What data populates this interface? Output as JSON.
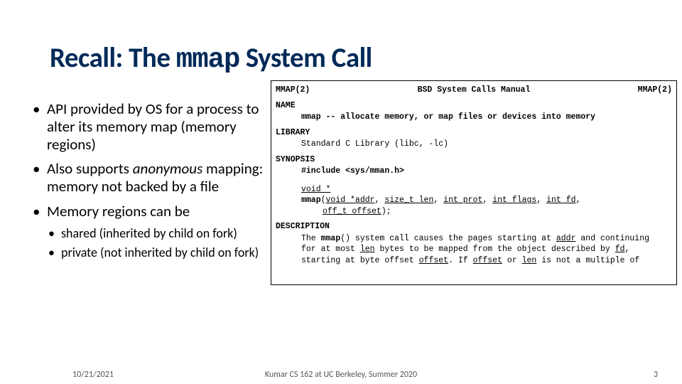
{
  "title": {
    "prefix": "Recall: The ",
    "code": "mmap",
    "suffix": " System Call"
  },
  "bullets": {
    "b1": "API provided by OS for a process to alter its memory map (memory regions)",
    "b2_pre": "Also supports ",
    "b2_em": "anonymous",
    "b2_post": " mapping: memory not backed by a file",
    "b3": "Memory regions can be",
    "sub1": "shared (inherited by child on fork)",
    "sub2": "private (not inherited by child on fork)"
  },
  "man": {
    "hdr_left": "MMAP(2)",
    "hdr_center": "BSD System Calls Manual",
    "hdr_right": "MMAP(2)",
    "sect_name": "NAME",
    "name_line": "mmap -- allocate memory, or map files or devices into memory",
    "sect_lib": "LIBRARY",
    "lib_line": "Standard C Library (libc, -lc)",
    "sect_syn": "SYNOPSIS",
    "syn_include": "#include <sys/mman.h>",
    "syn_ret_u": "void *",
    "syn_fn": "mmap",
    "syn_a1_u": "void *addr",
    "syn_a2_u": "size_t len",
    "syn_a3_u": "int prot",
    "syn_a4_u": "int flags",
    "syn_a5_u": "int fd",
    "syn_a6_u": "off_t offset",
    "sect_desc": "DESCRIPTION",
    "desc_l1_a": "The ",
    "desc_l1_b": "mmap",
    "desc_l1_c": "() system call causes the pages starting at ",
    "desc_l1_d": "addr",
    "desc_l1_e": " and continuing",
    "desc_l2_a": "for at most ",
    "desc_l2_b": "len",
    "desc_l2_c": " bytes to be mapped from the object described by ",
    "desc_l2_d": "fd",
    "desc_l2_e": ",",
    "desc_l3_a": "starting at byte offset ",
    "desc_l3_b": "offset",
    "desc_l3_c": ".  If ",
    "desc_l3_d": "offset",
    "desc_l3_e": " or ",
    "desc_l3_f": "len",
    "desc_l3_g": " is not a multiple of"
  },
  "footer": {
    "date": "10/21/2021",
    "center": "Kumar CS 162 at UC Berkeley, Summer 2020",
    "page": "3"
  }
}
